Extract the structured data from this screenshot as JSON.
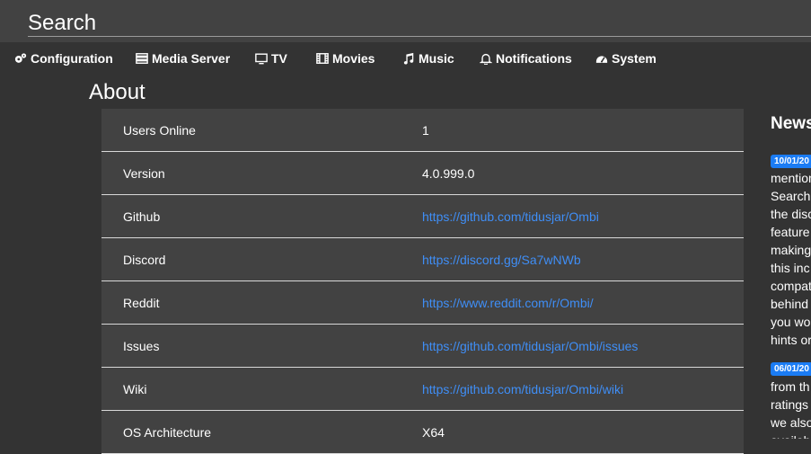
{
  "search": {
    "placeholder": "Search"
  },
  "nav": {
    "items": [
      {
        "label": "Configuration",
        "icon": "gears-icon"
      },
      {
        "label": "Media Server",
        "icon": "server-icon"
      },
      {
        "label": "TV",
        "icon": "tv-icon"
      },
      {
        "label": "Movies",
        "icon": "film-icon"
      },
      {
        "label": "Music",
        "icon": "music-note-icon"
      },
      {
        "label": "Notifications",
        "icon": "bell-icon"
      },
      {
        "label": "System",
        "icon": "dashboard-icon"
      }
    ]
  },
  "page": {
    "title": "About"
  },
  "about": {
    "rows": [
      {
        "label": "Users Online",
        "value": "1"
      },
      {
        "label": "Version",
        "value": "4.0.999.0"
      },
      {
        "label": "Github",
        "value": "https://github.com/tidusjar/Ombi"
      },
      {
        "label": "Discord",
        "value": "https://discord.gg/Sa7wNWb"
      },
      {
        "label": "Reddit",
        "value": "https://www.reddit.com/r/Ombi/"
      },
      {
        "label": "Issues",
        "value": "https://github.com/tidusjar/Ombi/issues"
      },
      {
        "label": "Wiki",
        "value": "https://github.com/tidusjar/Ombi/wiki"
      },
      {
        "label": "OS Architecture",
        "value": "X64"
      }
    ]
  },
  "news": {
    "title": "News",
    "items": [
      {
        "date": "10/01/20",
        "lines": [
          "mentione",
          "Searchi",
          "the disc",
          "feature",
          "making",
          "this inc",
          "compat",
          "behind",
          "you wo",
          "hints or"
        ]
      },
      {
        "date": "06/01/20",
        "lines": [
          "from th",
          "ratings",
          "we also",
          "availab"
        ]
      }
    ]
  },
  "colors": {
    "link": "#3f8ef6",
    "badge": "#1b7cf4",
    "panel": "#424242",
    "background": "#333333"
  }
}
